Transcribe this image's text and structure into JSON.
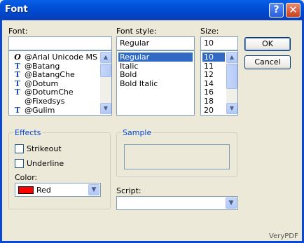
{
  "window": {
    "title": "Font"
  },
  "titlebar_buttons": {
    "help": "?",
    "close": "✕"
  },
  "font": {
    "label": "Font:",
    "value": "",
    "items": [
      {
        "icon": "opentype",
        "glyph": "O",
        "name": "@Arial Unicode MS",
        "selected": false
      },
      {
        "icon": "truetype",
        "glyph": "T",
        "name": "@Batang",
        "selected": false
      },
      {
        "icon": "truetype",
        "glyph": "T",
        "name": "@BatangChe",
        "selected": false
      },
      {
        "icon": "truetype",
        "glyph": "T",
        "name": "@Dotum",
        "selected": false
      },
      {
        "icon": "truetype",
        "glyph": "T",
        "name": "@DotumChe",
        "selected": false
      },
      {
        "icon": "none",
        "glyph": "",
        "name": "@Fixedsys",
        "selected": false
      },
      {
        "icon": "truetype",
        "glyph": "T",
        "name": "@Gulim",
        "selected": false
      }
    ]
  },
  "font_style": {
    "label": "Font style:",
    "value": "Regular",
    "items": [
      {
        "name": "Regular",
        "selected": true
      },
      {
        "name": "Italic",
        "selected": false
      },
      {
        "name": "Bold",
        "selected": false
      },
      {
        "name": "Bold Italic",
        "selected": false
      }
    ]
  },
  "size": {
    "label": "Size:",
    "value": "10",
    "items": [
      {
        "name": "10",
        "selected": true
      },
      {
        "name": "11",
        "selected": false
      },
      {
        "name": "12",
        "selected": false
      },
      {
        "name": "14",
        "selected": false
      },
      {
        "name": "16",
        "selected": false
      },
      {
        "name": "18",
        "selected": false
      },
      {
        "name": "20",
        "selected": false
      }
    ]
  },
  "buttons": {
    "ok": "OK",
    "cancel": "Cancel"
  },
  "effects": {
    "legend": "Effects",
    "strikeout": {
      "label": "Strikeout",
      "checked": false
    },
    "underline": {
      "label": "Underline",
      "checked": false
    },
    "color_label": "Color:",
    "color_value": "Red",
    "color_hex": "#ff0000"
  },
  "sample": {
    "legend": "Sample"
  },
  "script": {
    "label": "Script:",
    "value": ""
  },
  "watermark": "VeryPDF",
  "colors": {
    "accent": "#0046d5",
    "selection": "#316ac5",
    "titlebar": "#0050d8"
  }
}
